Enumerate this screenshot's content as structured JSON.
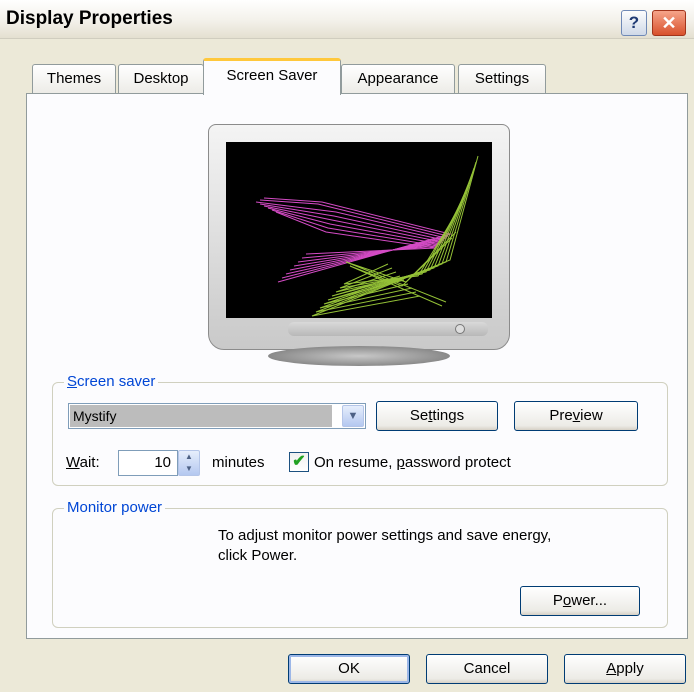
{
  "window": {
    "title": "Display Properties",
    "help_glyph": "?",
    "close_glyph": "✕"
  },
  "tabs": [
    {
      "label": "Themes"
    },
    {
      "label": "Desktop"
    },
    {
      "label": "Screen Saver",
      "active": true
    },
    {
      "label": "Appearance"
    },
    {
      "label": "Settings"
    }
  ],
  "screen_saver": {
    "group_label_first": "S",
    "group_label_rest": "creen saver",
    "selected": "Mystify",
    "settings_pre": "Se",
    "settings_u": "t",
    "settings_post": "tings",
    "preview_pre": "Pre",
    "preview_u": "v",
    "preview_post": "iew",
    "wait_u": "W",
    "wait_rest": "ait:",
    "wait_value": "10",
    "minutes_label": "minutes",
    "password_pre": "On resume, ",
    "password_u": "p",
    "password_post": "assword protect",
    "password_checked": true
  },
  "monitor_power": {
    "group_label": "Monitor power",
    "description_line1": "To adjust monitor power settings and save energy,",
    "description_line2": "click Power.",
    "power_pre": "P",
    "power_u": "o",
    "power_post": "wer..."
  },
  "footer": {
    "ok": "OK",
    "cancel": "Cancel",
    "apply_u": "A",
    "apply_rest": "pply"
  },
  "colors": {
    "dialog_bg": "#ece9d8",
    "group_label": "#0046d5",
    "active_tab_accent": "#ffc83c",
    "preview_pink": "#e050d0",
    "preview_green": "#9ccc3a"
  }
}
